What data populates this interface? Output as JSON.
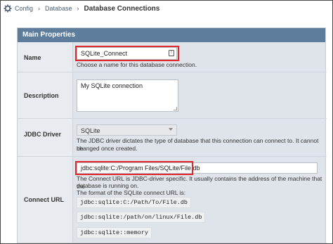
{
  "breadcrumb": {
    "items": [
      "Config",
      "Database"
    ],
    "current": "Database Connections",
    "separator": "›"
  },
  "panel": {
    "header": "Main Properties"
  },
  "fields": {
    "name": {
      "label": "Name",
      "value": "SQLite_Connect",
      "help": "Choose a name for this database connection."
    },
    "description": {
      "label": "Description",
      "value": "My SQLite connection"
    },
    "jdbc_driver": {
      "label": "JDBC Driver",
      "value": "SQLite",
      "help_line1": "The JDBC driver dictates the type of database that this connection can connect to. It cannot be",
      "help_line2": "changed once created."
    },
    "connect_url": {
      "label": "Connect URL",
      "value": "jdbc:sqlite:C:/Program Files/SQLite/File.db",
      "help_line1": "The Connect URL is JDBC-driver specific. It usually contains the address of the machine that the",
      "help_line2": "database is running on.",
      "help_line3": "The format of the SQLite connect URL is:",
      "examples": [
        "jdbc:sqlite:C:/Path/To/File.db",
        "jdbc:sqlite:/path/on/linux/File.db",
        "jdbc:sqlite::memory"
      ]
    }
  },
  "colors": {
    "header_bg": "#5e7d9c",
    "panel_bg": "#dfe4ea",
    "highlight": "#e0282e"
  }
}
